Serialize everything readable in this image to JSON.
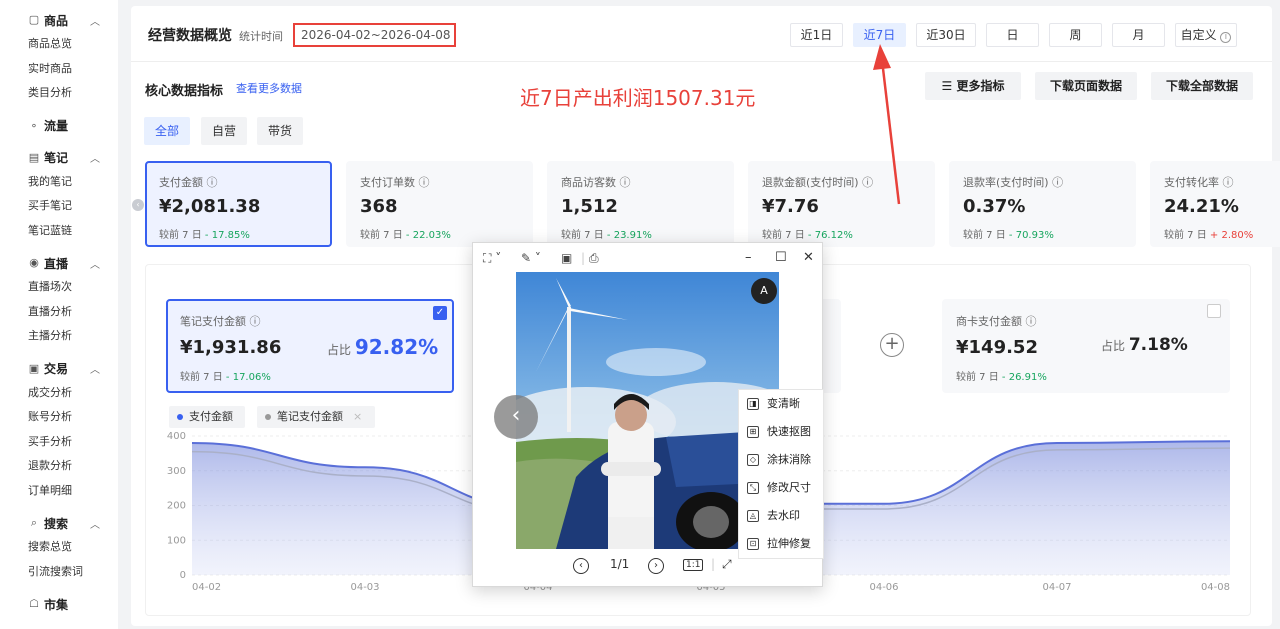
{
  "sidebar": {
    "groups": [
      {
        "icon": "goods-icon",
        "title": "商品",
        "items": [
          "商品总览",
          "实时商品",
          "类目分析"
        ]
      },
      {
        "icon": "traffic-icon",
        "title": "流量",
        "items": []
      },
      {
        "icon": "notes-icon",
        "title": "笔记",
        "items": [
          "我的笔记",
          "买手笔记",
          "笔记蓝链"
        ]
      },
      {
        "icon": "live-icon",
        "title": "直播",
        "items": [
          "直播场次",
          "直播分析",
          "主播分析"
        ]
      },
      {
        "icon": "trade-icon",
        "title": "交易",
        "items": [
          "成交分析",
          "账号分析",
          "买手分析",
          "退款分析",
          "订单明细"
        ]
      },
      {
        "icon": "search-icon",
        "title": "搜索",
        "items": [
          "搜索总览",
          "引流搜索词"
        ]
      },
      {
        "icon": "market-icon",
        "title": "市集",
        "items": []
      }
    ]
  },
  "header": {
    "title": "经营数据概览",
    "stat_label": "统计时间",
    "date_range": "2026-04-02~2026-04-08",
    "ranges": [
      "近1日",
      "近7日",
      "近30日",
      "日",
      "周",
      "月",
      "自定义"
    ],
    "active_range": "近7日"
  },
  "core": {
    "title": "核心数据指标",
    "more_link": "查看更多数据",
    "annotation": "近7日产出利润1507.31元",
    "tools": [
      "更多指标",
      "下载页面数据",
      "下载全部数据"
    ],
    "segments": [
      "全部",
      "自营",
      "带货"
    ],
    "active_segment": "全部"
  },
  "kpis": [
    {
      "label": "支付金额",
      "value": "¥2,081.38",
      "cmp_label": "较前 7 日",
      "cmp": "- 17.85%",
      "trend": "down"
    },
    {
      "label": "支付订单数",
      "value": "368",
      "cmp_label": "较前 7 日",
      "cmp": "- 22.03%",
      "trend": "down"
    },
    {
      "label": "商品访客数",
      "value": "1,512",
      "cmp_label": "较前 7 日",
      "cmp": "- 23.91%",
      "trend": "down"
    },
    {
      "label": "退款金额(支付时间)",
      "value": "¥7.76",
      "cmp_label": "较前 7 日",
      "cmp": "- 76.12%",
      "trend": "down"
    },
    {
      "label": "退款率(支付时间)",
      "value": "0.37%",
      "cmp_label": "较前 7 日",
      "cmp": "- 70.93%",
      "trend": "down"
    },
    {
      "label": "支付转化率",
      "value": "24.21%",
      "cmp_label": "较前 7 日",
      "cmp": "+ 2.80%",
      "trend": "up"
    }
  ],
  "sub_cards": [
    {
      "label": "笔记支付金额",
      "value": "¥1,931.86",
      "share_label": "占比",
      "share": "92.82%",
      "cmp_label": "较前 7 日",
      "cmp": "- 17.06%"
    },
    {
      "label": "商卡支付金额",
      "value": "¥149.52",
      "share_label": "占比",
      "share": "7.18%",
      "cmp_label": "较前 7 日",
      "cmp": "- 26.91%"
    }
  ],
  "legend": [
    {
      "name": "支付金额",
      "color": "#3860f0"
    },
    {
      "name": "笔记支付金额",
      "color": "#999999",
      "close": "×"
    }
  ],
  "chart_data": {
    "type": "area",
    "x": [
      "04-02",
      "04-03",
      "04-04",
      "04-05",
      "04-06",
      "04-07",
      "04-08"
    ],
    "ylim": [
      0,
      400
    ],
    "yticks": [
      0,
      100,
      200,
      300,
      400
    ],
    "series": [
      {
        "name": "支付金额",
        "values": [
          380,
          310,
          190,
          205,
          205,
          380,
          385
        ]
      },
      {
        "name": "笔记支付金额",
        "values": [
          355,
          285,
          175,
          190,
          190,
          360,
          365
        ]
      }
    ]
  },
  "viewer": {
    "page": "1/1",
    "ratio": "1:1",
    "ocr": "A",
    "tools": [
      "变清晰",
      "快速抠图",
      "涂抹消除",
      "修改尺寸",
      "去水印",
      "拉伸修复"
    ]
  },
  "colors": {
    "accent": "#3860f0",
    "annotation": "#e8413a",
    "down": "#17a55e",
    "up": "#e8413a"
  }
}
